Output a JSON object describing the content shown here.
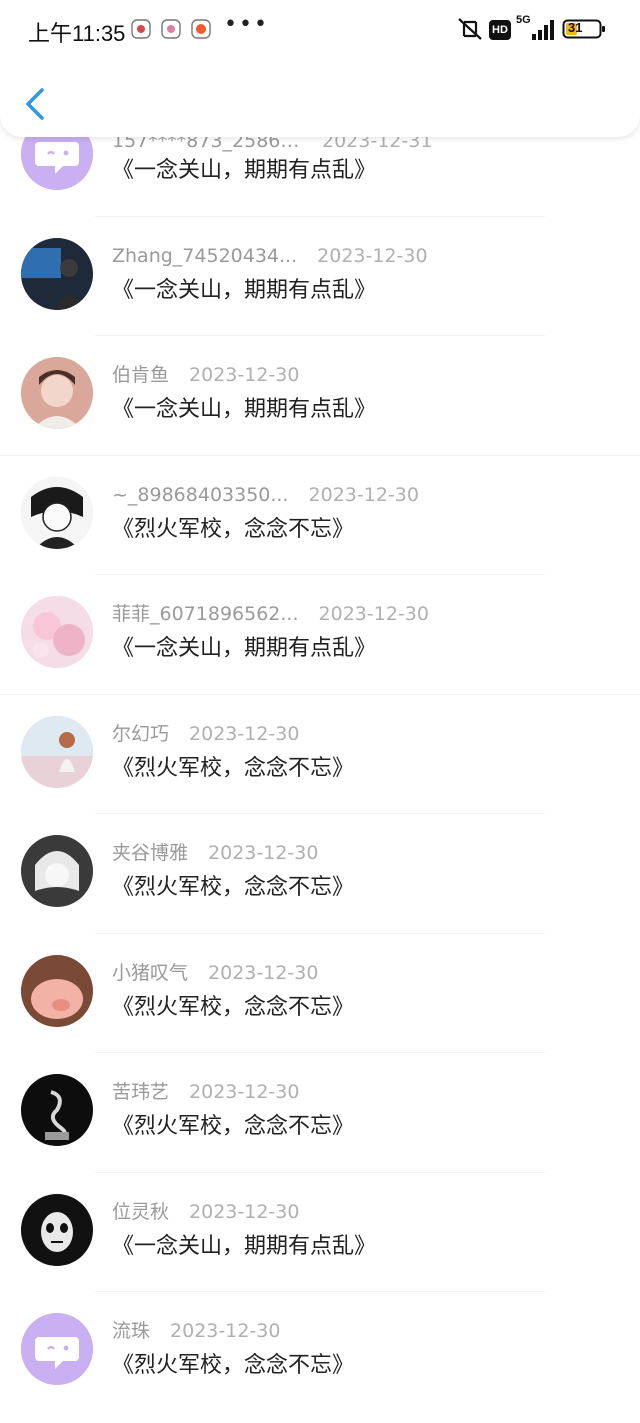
{
  "status_bar": {
    "time": "上午11:35",
    "network": "5G",
    "hd": "HD",
    "battery": "31"
  },
  "nav": {
    "back_icon": "chevron-left-icon"
  },
  "colors": {
    "accent": "#2f97e8",
    "avatar_purple": "#c9b0f2"
  },
  "entries": [
    {
      "name": "157****873_25864...",
      "date": "2023-12-31",
      "book": "《一念关山，期期有点乱》",
      "avatar": "default-chat-avatar"
    },
    {
      "name": "Zhang_74520434...",
      "date": "2023-12-30",
      "book": "《一念关山，期期有点乱》",
      "avatar": "photo-avatar"
    },
    {
      "name": "伯肯鱼",
      "date": "2023-12-30",
      "book": "《一念关山，期期有点乱》",
      "avatar": "photo-avatar"
    },
    {
      "name": "~_89868403350...",
      "date": "2023-12-30",
      "book": "《烈火军校，念念不忘》",
      "avatar": "photo-avatar"
    },
    {
      "name": "菲菲_6071896562...",
      "date": "2023-12-30",
      "book": "《一念关山，期期有点乱》",
      "avatar": "photo-avatar"
    },
    {
      "name": "尔幻巧",
      "date": "2023-12-30",
      "book": "《烈火军校，念念不忘》",
      "avatar": "photo-avatar"
    },
    {
      "name": "夹谷博雅",
      "date": "2023-12-30",
      "book": "《烈火军校，念念不忘》",
      "avatar": "photo-avatar"
    },
    {
      "name": "小猪叹气",
      "date": "2023-12-30",
      "book": "《烈火军校，念念不忘》",
      "avatar": "photo-avatar"
    },
    {
      "name": "苦玮艺",
      "date": "2023-12-30",
      "book": "《烈火军校，念念不忘》",
      "avatar": "photo-avatar"
    },
    {
      "name": "位灵秋",
      "date": "2023-12-30",
      "book": "《一念关山，期期有点乱》",
      "avatar": "photo-avatar"
    },
    {
      "name": "流珠",
      "date": "2023-12-30",
      "book": "《烈火军校，念念不忘》",
      "avatar": "default-chat-avatar"
    }
  ]
}
